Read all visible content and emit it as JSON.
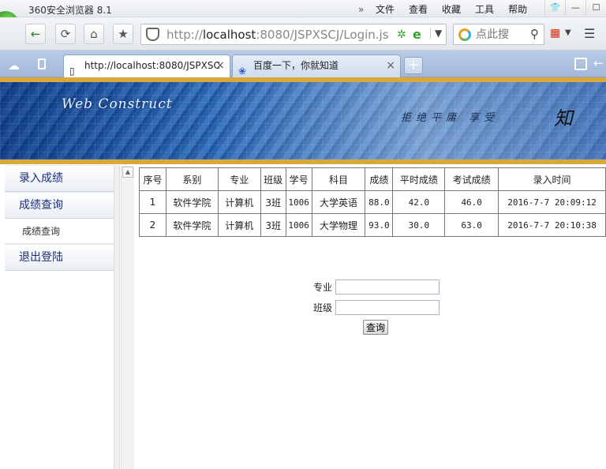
{
  "browser": {
    "app_title": "360安全浏览器 8.1",
    "menu": [
      "文件",
      "查看",
      "收藏",
      "工具",
      "帮助"
    ],
    "address_url_prefix": "http://",
    "address_url_host": "localhost",
    "address_url_rest": ":8080/JSPXSCJ/Login.js",
    "search_placeholder": "点此搜",
    "tabs": [
      {
        "label": "http://localhost:8080/JSPXSC",
        "active": true
      },
      {
        "label": "百度一下，你就知道",
        "active": false
      }
    ]
  },
  "page": {
    "banner_logo_text": "Web Construct",
    "banner_motto": "拒绝平庸 享受",
    "banner_char": "知",
    "sidebar": {
      "items": [
        {
          "label": "录入成绩",
          "type": "head"
        },
        {
          "label": "成绩查询",
          "type": "head"
        },
        {
          "label": "成绩查询",
          "type": "sub"
        },
        {
          "label": "退出登陆",
          "type": "head"
        }
      ]
    },
    "table": {
      "headers": [
        "序号",
        "系别",
        "专业",
        "班级",
        "学号",
        "科目",
        "成绩",
        "平时成绩",
        "考试成绩",
        "录入时间"
      ],
      "rows": [
        [
          "1",
          "软件学院",
          "计算机",
          "3班",
          "1006",
          "大学英语",
          "88.0",
          "42.0",
          "46.0",
          "2016-7-7 20:09:12"
        ],
        [
          "2",
          "软件学院",
          "计算机",
          "3班",
          "1006",
          "大学物理",
          "93.0",
          "30.0",
          "63.0",
          "2016-7-7 20:10:38"
        ]
      ]
    },
    "form": {
      "major_label": "专业",
      "major_value": "",
      "class_label": "班级",
      "class_value": "",
      "submit_label": "查询"
    }
  }
}
